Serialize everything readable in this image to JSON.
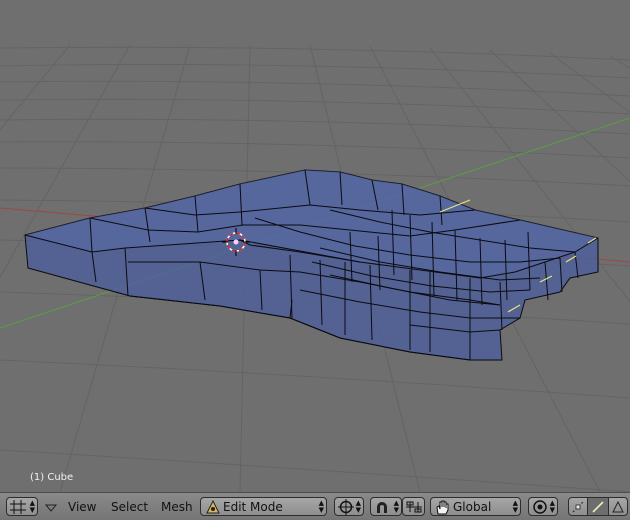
{
  "viewport": {
    "object_label": "(1) Cube"
  },
  "header": {
    "menus": [
      "View",
      "Select",
      "Mesh"
    ],
    "mode": "Edit Mode",
    "orientation": "Global"
  },
  "icons": {
    "editor_type": "grid-icon",
    "collapse": "triangle-down-icon",
    "mode": "edit-mode-icon",
    "pivot": "pivot-icon",
    "snap": "magnet-icon",
    "manipulator": "manipulator-icon",
    "orientation": "hand-icon",
    "proportional": "proportional-edit-icon",
    "select_vertex": "vertex-select-icon",
    "select_edge": "edge-select-icon",
    "select_face": "face-select-icon"
  },
  "colors": {
    "background": "#6f6f6f",
    "grid": "#636363",
    "x_axis": "#a14545",
    "y_axis": "#5f9a45",
    "mesh_fill": "#4b5f9e",
    "mesh_edge": "#0a0a10",
    "selected_edge": "#e6e67a"
  }
}
